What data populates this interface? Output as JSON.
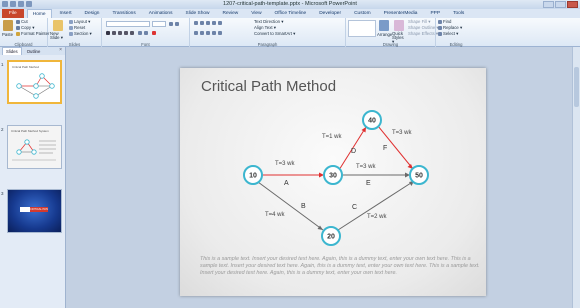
{
  "window": {
    "title": "1207-critical-path-template.pptx - Microsoft PowerPoint"
  },
  "tabs": [
    {
      "label": "File"
    },
    {
      "label": "Home"
    },
    {
      "label": "Insert"
    },
    {
      "label": "Design"
    },
    {
      "label": "Transitions"
    },
    {
      "label": "Animations"
    },
    {
      "label": "Slide Show"
    },
    {
      "label": "Review"
    },
    {
      "label": "View"
    },
    {
      "label": "Office Timeline"
    },
    {
      "label": "Developer"
    },
    {
      "label": "Custom"
    },
    {
      "label": "PresenterMedia"
    },
    {
      "label": "PPP"
    },
    {
      "label": "Tools"
    }
  ],
  "ribbon": {
    "clipboard": {
      "paste": "Paste",
      "cut": "Cut",
      "copy": "Copy ▾",
      "format_painter": "Format Painter",
      "label": "Clipboard"
    },
    "slides": {
      "new_slide": "New Slide ▾",
      "layout": "Layout ▾",
      "reset": "Reset",
      "section": "Section ▾",
      "label": "Slides"
    },
    "font": {
      "label": "Font"
    },
    "paragraph": {
      "text_direction": "Text Direction ▾",
      "align_text": "Align Text ▾",
      "convert_smartart": "Convert to SmartArt ▾",
      "label": "Paragraph"
    },
    "drawing": {
      "arrange": "Arrange",
      "quick_styles": "Quick Styles ▾",
      "shape_fill": "Shape Fill ▾",
      "shape_outline": "Shape Outline ▾",
      "shape_effects": "Shape Effects ▾",
      "label": "Drawing"
    },
    "editing": {
      "find": "Find",
      "replace": "Replace ▾",
      "select": "Select ▾",
      "label": "Editing"
    }
  },
  "left_pane": {
    "tabs": [
      "Slides",
      "Outline"
    ],
    "close": "×",
    "thumbnails": [
      {
        "number": "1",
        "title": "Critical Path Method"
      },
      {
        "number": "2",
        "title": "Critical Path Method System"
      },
      {
        "number": "3",
        "title": "CRITICAL PATH"
      }
    ]
  },
  "slide": {
    "title": "Critical Path Method",
    "nodes": [
      "10",
      "30",
      "40",
      "50",
      "20"
    ],
    "edges": [
      {
        "from": "10",
        "to": "30",
        "duration": "T=3 wk",
        "letter": "A",
        "critical": true
      },
      {
        "from": "10",
        "to": "20",
        "duration": "T=4 wk",
        "letter": "B",
        "critical": false
      },
      {
        "from": "20",
        "to": "50",
        "duration": "T=2 wk",
        "letter": "C",
        "critical": false
      },
      {
        "from": "30",
        "to": "40",
        "duration": "T=1 wk",
        "letter": "D",
        "critical": true
      },
      {
        "from": "30",
        "to": "50",
        "duration": "T=3 wk",
        "letter": "E",
        "critical": false
      },
      {
        "from": "40",
        "to": "50",
        "duration": "T=3 wk",
        "letter": "F",
        "critical": true
      }
    ],
    "sample_text": "This is a sample text. Insert your desired text here. Again, this is a dummy text, enter your own text here. This is a sample text. Insert your desired text here. Again, this is a dummy text, enter your own text here. This is a sample text. Insert your desired text here. Again, this is a dummy text, enter your own text here."
  },
  "colors": {
    "critical": "#e03030",
    "normal": "#6a6a6a",
    "node_border": "#3cb6cf"
  }
}
